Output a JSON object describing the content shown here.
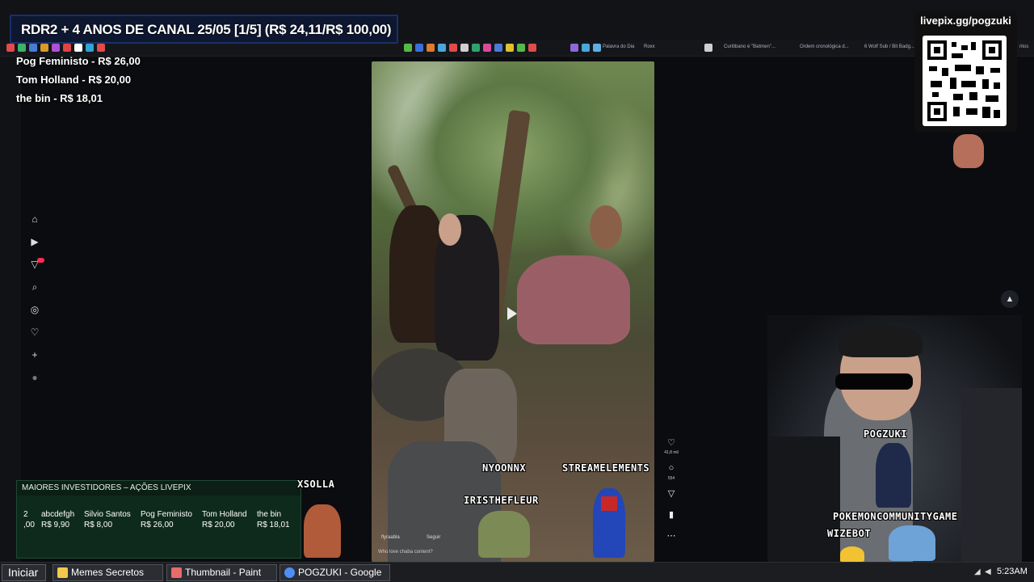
{
  "title_banner": "RDR2 + 4 ANOS DE CANAL 25/05 [1/5] (R$ 24,11/R$ 100,00)",
  "top_donations": [
    "Pog Feministo - R$ 26,00",
    "Tom Holland - R$ 20,00",
    "the bin - R$ 18,01"
  ],
  "bookmarks": [
    "Palavra do Dia",
    "Roxx",
    "Curitibano é \"Batmen\"...",
    "Ordem cronológica d...",
    "6 Wolf Sub / Bit Badg...",
    "ritos"
  ],
  "livepix": {
    "label": "livepix.gg/pogzuki"
  },
  "video": {
    "likes": "41,8 mil",
    "comments": "554",
    "caption_user": "flyraabla",
    "caption_follow": "Seguir",
    "caption_text": "Who love chaba content?"
  },
  "investors": {
    "title": "MAIORES INVESTIDORES – AÇÕES LIVEPIX",
    "items": [
      {
        "name": "2",
        "value": ",00"
      },
      {
        "name": "abcdefgh",
        "value": "R$ 9,90"
      },
      {
        "name": "Silvio Santos",
        "value": "R$ 8,00"
      },
      {
        "name": "Pog Feministo",
        "value": "R$ 26,00"
      },
      {
        "name": "Tom Holland",
        "value": "R$ 20,00"
      },
      {
        "name": "the bin",
        "value": "R$ 18,01"
      }
    ]
  },
  "chat_names": {
    "xsolla": "XSOLLA",
    "nyoonnx": "NYOONNX",
    "streamelements": "STREAMELEMENTS",
    "iristhefleur": "IRISTHEFLEUR",
    "pogzuki": "POGZUKI",
    "pokemon": "POKEMONCOMMUNITYGAME",
    "wizebot": "WIZEBOT"
  },
  "taskbar": {
    "start": "Iniciar",
    "items": [
      {
        "label": "Memes Secretos",
        "icon_color": "#f2c94c"
      },
      {
        "label": "Thumbnail - Paint",
        "icon_color": "#e86b6b"
      },
      {
        "label": "POGZUKI - Google",
        "icon_color": "#4f8ef7"
      }
    ],
    "clock": "5:23AM"
  }
}
